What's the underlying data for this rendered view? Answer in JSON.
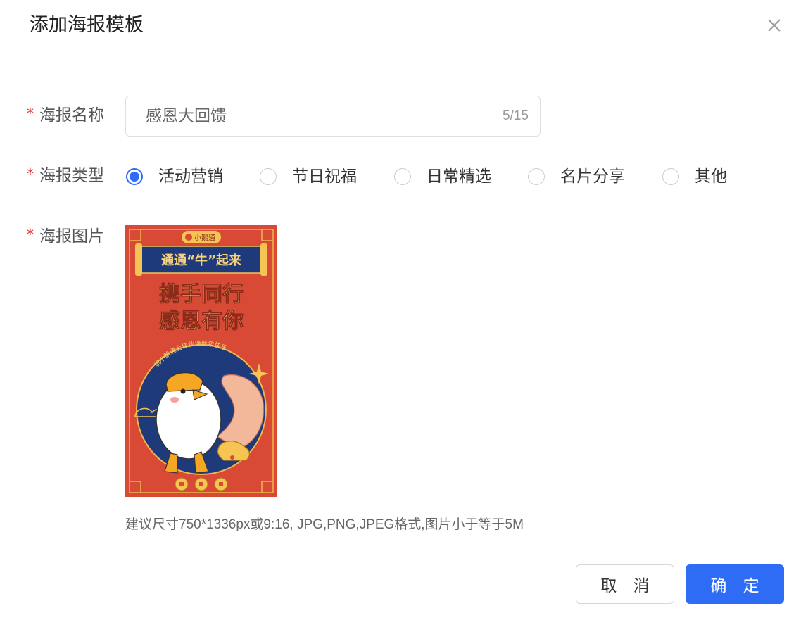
{
  "dialog": {
    "title": "添加海报模板",
    "close_icon": "close-icon"
  },
  "form": {
    "required_mark": "*",
    "name_label": "海报名称",
    "name_value": "感恩大回馈",
    "name_count": "5/15",
    "type_label": "海报类型",
    "type_options": [
      {
        "label": "活动营销",
        "selected": true
      },
      {
        "label": "节日祝福",
        "selected": false
      },
      {
        "label": "日常精选",
        "selected": false
      },
      {
        "label": "名片分享",
        "selected": false
      },
      {
        "label": "其他",
        "selected": false
      }
    ],
    "image_label": "海报图片",
    "hint": "建议尺寸750*1336px或9:16, JPG,PNG,JPEG格式,图片小于等于5M"
  },
  "poster": {
    "brand": "小鹅通",
    "banner": "通通“牛”起来",
    "headline1": "携手同行",
    "headline2": "感恩有你",
    "arc_text": "祝小鹅通合作伙伴新年快乐"
  },
  "footer": {
    "cancel_label": "取 消",
    "ok_label": "确 定"
  },
  "colors": {
    "accent": "#2e6cf6",
    "required": "#e53935",
    "poster_red": "#d84a35",
    "poster_navy": "#1f3a7a",
    "poster_gold": "#f6c453"
  }
}
